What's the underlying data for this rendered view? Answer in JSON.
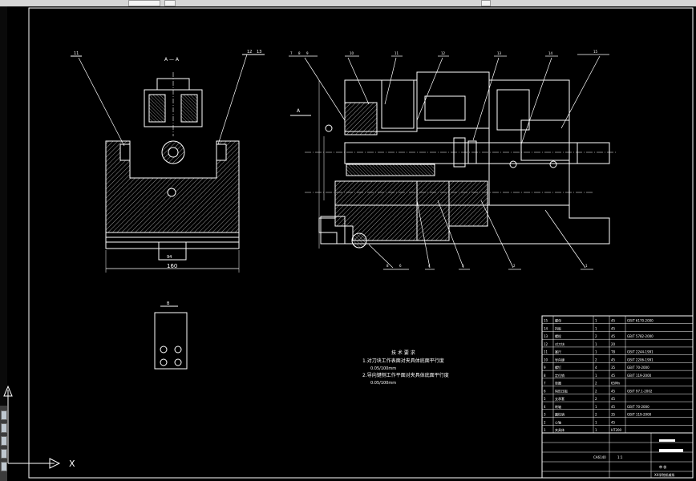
{
  "app": {
    "toolbar_buttons": [
      "",
      "",
      ""
    ]
  },
  "view_a": {
    "title": "A — A",
    "dimension_bottom": "160",
    "dimension_inner": "94",
    "balloons": [
      "11",
      "12",
      "13"
    ]
  },
  "main_view": {
    "section_mark": "A",
    "balloons": [
      "7",
      "8",
      "9",
      "10",
      "11",
      "12",
      "13",
      "14",
      "15"
    ],
    "bottom_balloons": [
      "8",
      "6",
      "4",
      "3",
      "2",
      "1"
    ]
  },
  "view_b": {
    "title": "B"
  },
  "tech_requirements": {
    "title": "技 术 要 求",
    "line1": "1.对刀块工作表面对夹具体底面平行度",
    "line1_value": "0.05/100mm",
    "line2": "2.导向键侧工作平面对夹具体底面平行度",
    "line2_value": "0.05/100mm"
  },
  "bom": {
    "rows": [
      [
        "15",
        "螺母",
        "1",
        "45",
        "GB/T 6170-2000"
      ],
      [
        "14",
        "挡板",
        "1",
        "45",
        ""
      ],
      [
        "13",
        "螺栓",
        "2",
        "45",
        "GB/T 5782-2000"
      ],
      [
        "12",
        "对刀块",
        "1",
        "20",
        ""
      ],
      [
        "11",
        "塞尺",
        "1",
        "T8",
        "GB/T 2244-1991"
      ],
      [
        "10",
        "导向键",
        "2",
        "45",
        "GB/T 2206-1991"
      ],
      [
        "9",
        "螺钉",
        "4",
        "35",
        "GB/T 70-2000"
      ],
      [
        "8",
        "定位销",
        "1",
        "45",
        "GB/T 119-2000"
      ],
      [
        "7",
        "垫圈",
        "2",
        "65Mn",
        ""
      ],
      [
        "6",
        "钩形压板",
        "2",
        "45",
        "GB/T 97.1-2002"
      ],
      [
        "5",
        "支承套",
        "2",
        "45",
        ""
      ],
      [
        "4",
        "转轴",
        "1",
        "45",
        "GB/T 70-2000"
      ],
      [
        "3",
        "圆柱销",
        "2",
        "35",
        "GB/T 119-2000"
      ],
      [
        "2",
        "心轴",
        "1",
        "45",
        ""
      ],
      [
        "1",
        "夹具体",
        "1",
        "HT200",
        ""
      ]
    ],
    "title_block_code": "CA6140",
    "scale": "1:1",
    "designer": "审 核",
    "school": "XX学院机械系"
  },
  "ucs": {
    "x_label": "X",
    "y_label": "Y"
  },
  "colors": {
    "background": "#000000",
    "lines": "#ffffff",
    "topbar": "#d6d6d6"
  }
}
